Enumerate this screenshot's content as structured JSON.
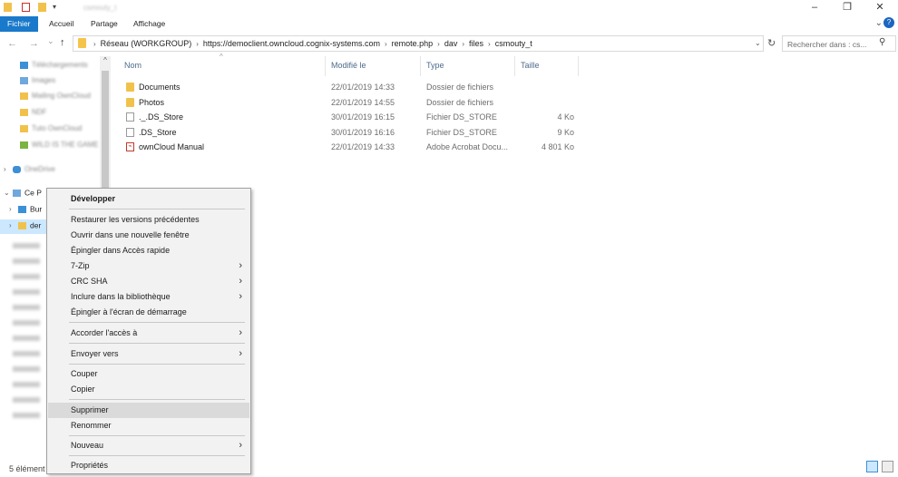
{
  "window": {
    "title": "csmouty_t",
    "minimize": "–",
    "restore": "❐",
    "close": "✕"
  },
  "ribbon": {
    "tabs": [
      "Fichier",
      "Accueil",
      "Partage",
      "Affichage"
    ],
    "expand_icon": "chevron-down-icon",
    "help_icon": "help-icon"
  },
  "address": {
    "back": "←",
    "forward": "→",
    "recent": "⌄",
    "up": "🡡",
    "breadcrumbs": [
      "Réseau (WORKGROUP)",
      "https://democlient.owncloud.cognix-systems.com",
      "remote.php",
      "dav",
      "files",
      "csmouty_t"
    ],
    "dropdown": "⌄",
    "refresh": "↻",
    "search_placeholder": "Rechercher dans : cs...",
    "search_glyph": "⚲"
  },
  "nav": {
    "items": [
      {
        "label": "Téléchargements",
        "blurred": true
      },
      {
        "label": "Images",
        "blurred": true
      },
      {
        "label": "Mailing OwnCloud",
        "blurred": true
      },
      {
        "label": "NDF",
        "blurred": true
      },
      {
        "label": "Tuto OwnCloud",
        "blurred": true
      },
      {
        "label": "WILD IS THE GAME",
        "blurred": true
      },
      {
        "label": "OneDrive",
        "blurred": true
      },
      {
        "label": "Ce P",
        "blurred": false
      },
      {
        "label": "Bur",
        "blurred": false
      },
      {
        "label": "der",
        "blurred": false
      }
    ],
    "chevron_right": "›",
    "chevron_down": "⌄",
    "scroll_up": "^"
  },
  "columns": {
    "name": "Nom",
    "modified": "Modifié le",
    "type": "Type",
    "size": "Taille",
    "sort_glyph": "^"
  },
  "files": [
    {
      "name": "Documents",
      "modified": "22/01/2019 14:33",
      "type": "Dossier de fichiers",
      "size": "",
      "kind": "folder"
    },
    {
      "name": "Photos",
      "modified": "22/01/2019 14:55",
      "type": "Dossier de fichiers",
      "size": "",
      "kind": "folder"
    },
    {
      "name": "._.DS_Store",
      "modified": "30/01/2019 16:15",
      "type": "Fichier DS_STORE",
      "size": "4 Ko",
      "kind": "file"
    },
    {
      "name": ".DS_Store",
      "modified": "30/01/2019 16:16",
      "type": "Fichier DS_STORE",
      "size": "9 Ko",
      "kind": "file"
    },
    {
      "name": "ownCloud Manual",
      "modified": "22/01/2019 14:33",
      "type": "Adobe Acrobat Docu...",
      "size": "4 801 Ko",
      "kind": "pdf"
    }
  ],
  "context_menu": {
    "items": [
      {
        "label": "Développer",
        "bold": true,
        "submenu": false
      },
      {
        "label": "Restaurer les versions précédentes",
        "submenu": false
      },
      {
        "label": "Ouvrir dans une nouvelle fenêtre",
        "submenu": false
      },
      {
        "label": "Épingler dans Accès rapide",
        "submenu": false
      },
      {
        "label": "7-Zip",
        "submenu": true
      },
      {
        "label": "CRC SHA",
        "submenu": true
      },
      {
        "label": "Inclure dans la bibliothèque",
        "submenu": true
      },
      {
        "label": "Épingler à l'écran de démarrage",
        "submenu": false
      },
      {
        "label": "Accorder l'accès à",
        "submenu": true
      },
      {
        "label": "Envoyer vers",
        "submenu": true
      },
      {
        "label": "Couper",
        "submenu": false
      },
      {
        "label": "Copier",
        "submenu": false
      },
      {
        "label": "Supprimer",
        "submenu": false,
        "hover": true
      },
      {
        "label": "Renommer",
        "submenu": false
      },
      {
        "label": "Nouveau",
        "submenu": true
      },
      {
        "label": "Propriétés",
        "submenu": false
      }
    ],
    "arrow_glyph": "›"
  },
  "status": {
    "items_count": "5 élément"
  },
  "colors": {
    "accent": "#1979ca",
    "folder": "#f1c24b",
    "selection": "#cce8ff",
    "menu_bg": "#f2f2f2"
  }
}
